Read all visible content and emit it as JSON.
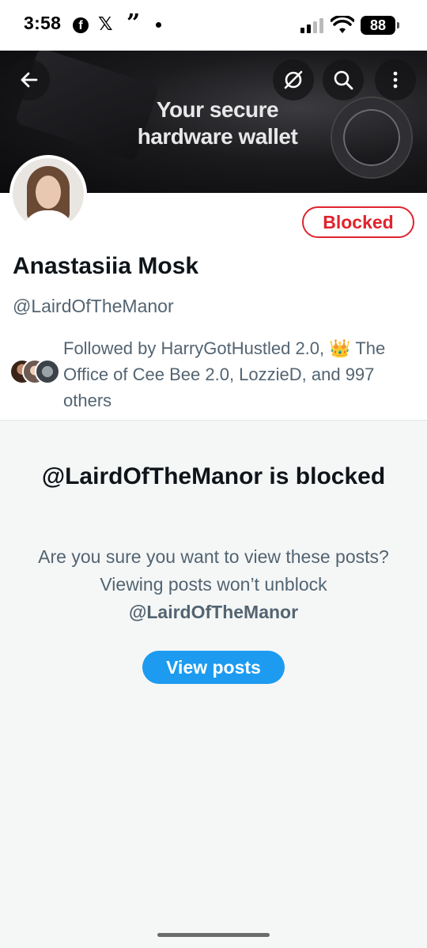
{
  "status_bar": {
    "time": "3:58",
    "apps": [
      "facebook-icon",
      "x-icon",
      "quote-icon",
      "dot"
    ],
    "battery": "88"
  },
  "banner": {
    "text_line1": "Your secure",
    "text_line2": "hardware wallet",
    "buttons": [
      "back-arrow-icon",
      "grok-icon",
      "search-icon",
      "more-vertical-icon"
    ]
  },
  "profile": {
    "name": "Anastasiia Mosk",
    "handle": "@LairdOfTheManor",
    "blocked_label": "Blocked",
    "followed_by": "Followed by HarryGotHustled 2.0, 👑 The Office of Cee Bee 2.0, LozzieD, and 997 others"
  },
  "blocked_notice": {
    "title": "@LairdOfTheManor is blocked",
    "description": "Are you sure you want to view these posts? Viewing posts won’t unblock",
    "handle": "@LairdOfTheManor",
    "button": "View posts"
  },
  "colors": {
    "blocked_red": "#e0232e",
    "link_blue": "#1d9bf0",
    "secondary_text": "#536471"
  }
}
